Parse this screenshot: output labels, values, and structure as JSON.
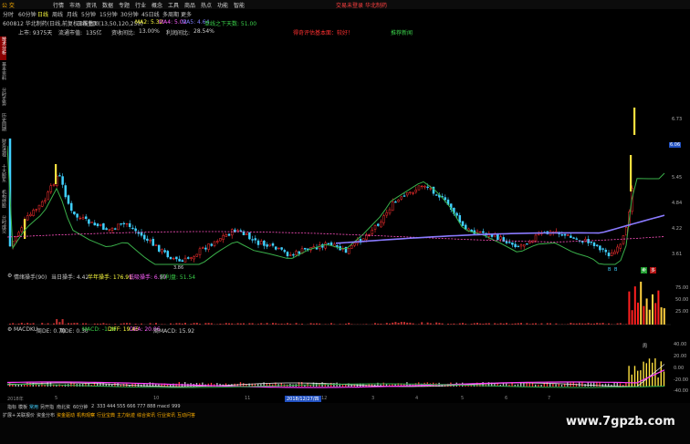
{
  "menu": {
    "items": [
      "行情",
      "市场",
      "资讯",
      "数据",
      "专题",
      "行业",
      "概念",
      "工具",
      "商品",
      "热点",
      "功能",
      "智能"
    ],
    "login": "交易未登录",
    "brand": "华北制药"
  },
  "logo": "公 交",
  "periods": [
    "分时",
    "60分钟",
    "日线",
    "周线",
    "月线",
    "5分钟",
    "15分钟",
    "30分钟",
    "45日线",
    "多周期",
    "更多"
  ],
  "active_period": "日线",
  "header": {
    "code_name": "600812 华北制药(日线,前复权)(前数)",
    "ma_label": "日线主图(13,50,120,250)",
    "ma2": "MA2: 5.32",
    "ma4": "MA4: 5.02",
    "ma5": "MA5: 4.64",
    "signal": "单线之下天数: 51.00"
  },
  "info": {
    "listed": "上市: 9375天",
    "float_label": "流通市值:",
    "float_value": "135亿",
    "shares_label": "资收间比:",
    "shares_value": "13.00%",
    "profit_label": "利润间比:",
    "profit_value": "28.54%",
    "warn": "得奇评估基本面：较好！",
    "right_tag": "推荐新闻"
  },
  "left_nav": [
    "技术分析",
    "基本资料",
    "分时走势",
    "历史同期",
    "财务透视",
    "十大股东",
    "机构持股",
    "分时成交"
  ],
  "left_nav_active": 0,
  "price_axis": [
    "6.73",
    "6.06",
    "5.45",
    "4.84",
    "4.22",
    "3.61"
  ],
  "price_marker": "6.06",
  "low_label": "3.86",
  "bottom_tags": [
    "B",
    "B",
    "卖",
    "多"
  ],
  "ind1": {
    "title": "情绪操手(90)",
    "today": "当日操手: 4.42",
    "half": "半年操手: 176.91",
    "lowv": "低吸操手: 6.99",
    "active": "获利盘: 51.54",
    "axis": [
      "75.00",
      "50.00",
      "25.00"
    ]
  },
  "ind2": {
    "title": "MACDKU",
    "a": "周DE: 0.70",
    "b": "周DE: 0.30",
    "c": "MACD: -1.20",
    "d": "DIFF: 19.46",
    "e": "DEA: 20.06",
    "f": "周MACD: 15.92",
    "axis": [
      "40.00",
      "20.00",
      "0.00",
      "-20.00",
      "-40.00"
    ],
    "tag": "周"
  },
  "xaxis": {
    "labels": [
      "2018年",
      "5",
      "10",
      "11",
      "12",
      "2018/12/27/四",
      "3",
      "4",
      "5",
      "6",
      "7"
    ]
  },
  "tabs": [
    "指标",
    "模板",
    "常用",
    "另开指",
    "南北资",
    "60分钟",
    "2",
    "333",
    "444",
    "555",
    "666",
    "777",
    "888",
    "macd",
    "999"
  ],
  "tabs_active": 2,
  "ext_tabs": [
    "扩展+",
    "关联报价",
    "资金分布",
    "资金驱动",
    "机构观察",
    "行业宝典",
    "主力轨迹",
    "综合资讯",
    "行业资讯",
    "互动问答"
  ],
  "watermark": "www.7gpzb.com",
  "colors": {
    "up": "#ff3030",
    "down": "#40d0ff",
    "ma_green": "#3ab04a",
    "ma_blue": "#8080ff",
    "ma_pink": "#ff50c0",
    "accent_yellow": "#ffff40"
  }
}
